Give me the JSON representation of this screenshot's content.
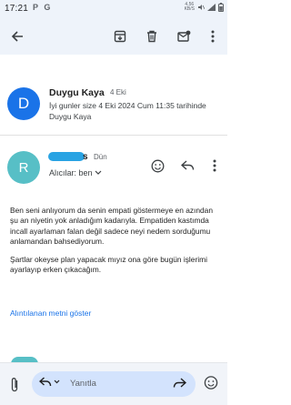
{
  "status": {
    "time": "17:21",
    "apps": "P G",
    "net_speed": "4,56",
    "net_unit": "KB/S"
  },
  "thread": {
    "sender": "Duygu Kaya",
    "date": "4 Eki",
    "snippet": "İyi gunler size 4 Eki 2024 Cum 11:35 tarihinde Duygu Kaya"
  },
  "message": {
    "avatar_letter": "R",
    "sender_suffix": "s",
    "date": "Dün",
    "recipients_label": "Alıcılar: ben",
    "paragraph_1": "Ben seni anlıyorum da senin empati göstermeye en azından şu an niyetin yok anladığım kadarıyla. Empatiden kastımda incall ayarlaman falan değil sadece neyi nedem sorduğumu anlamandan bahsediyorum.",
    "paragraph_2": "Şartlar okeyse plan yapacak mıyız ona göre bugün işlerimi ayarlayıp erken çıkacağım.",
    "quoted_link": "Alıntılanan metni göster"
  },
  "thread_avatar_letter": "D",
  "reply_bar": {
    "placeholder": "Yanıtla"
  },
  "colors": {
    "accent": "#1a73e8",
    "avatar_d": "#1a73e8",
    "avatar_r": "#57bfc6",
    "toolbar_bg": "#eef3fa",
    "reply_pill": "#d3e3fd"
  },
  "icons": [
    "back-arrow-icon",
    "archive-icon",
    "trash-icon",
    "mark-unread-icon",
    "more-vert-icon",
    "add-emoji-icon",
    "reply-icon",
    "forward-icon",
    "attach-icon",
    "chevron-down-icon"
  ]
}
